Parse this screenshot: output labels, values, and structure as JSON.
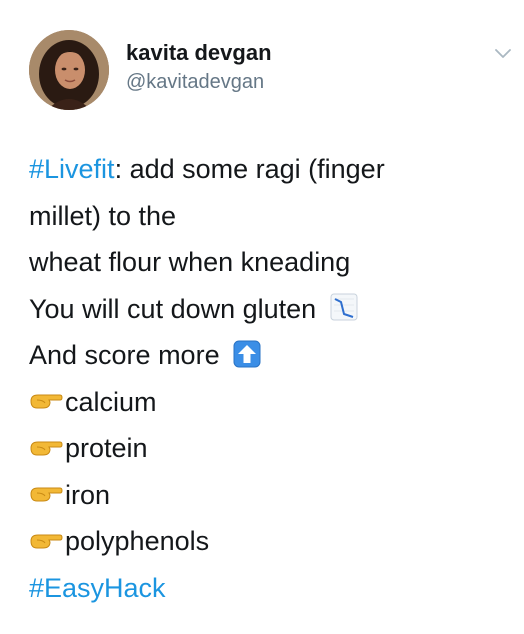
{
  "author": {
    "display_name": "kavita devgan",
    "handle": "@kavitadevgan"
  },
  "tweet": {
    "lead_hashtag": "#Livefit",
    "lead_text": ": add some ragi (finger",
    "line2": "millet) to the",
    "line3": "wheat flour when kneading",
    "line4": "You will cut down gluten",
    "line5": "And score more",
    "bullets": [
      "calcium",
      "protein",
      "iron",
      "polyphenols"
    ],
    "trail_hashtag": "#EasyHack"
  },
  "icons": {
    "down_chart": "chart-decreasing-icon",
    "up_arrow": "up-arrow-icon",
    "bullet": "pointing-right-icon",
    "menu": "chevron-down-icon"
  },
  "colors": {
    "hashtag": "#1b95e0",
    "text": "#14171a",
    "secondary": "#657786"
  }
}
